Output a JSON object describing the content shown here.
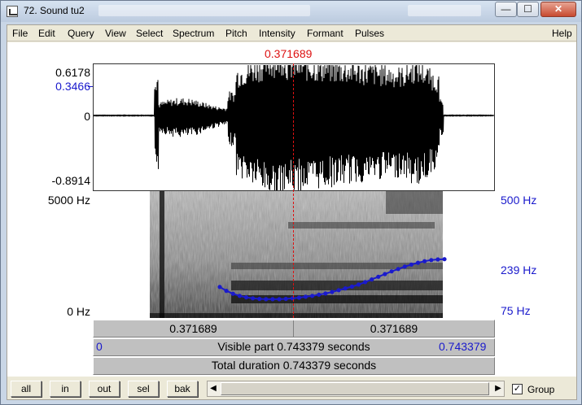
{
  "window": {
    "title": "72. Sound tu2",
    "controls": {
      "minimize": "—",
      "maximize": "☐",
      "close": "✕"
    }
  },
  "menu": [
    "File",
    "Edit",
    "Query",
    "View",
    "Select",
    "Spectrum",
    "Pitch",
    "Intensity",
    "Formant",
    "Pulses",
    "Help"
  ],
  "cursor": {
    "time": "0.371689",
    "color": "#dd1111"
  },
  "waveform": {
    "y_max": "0.6178",
    "y_marker": "0.3466",
    "y_zero": "0",
    "y_min": "-0.8914"
  },
  "spectrogram": {
    "freq_max": "5000 Hz",
    "freq_min": "0 Hz"
  },
  "pitch": {
    "ceiling": "500 Hz",
    "current": "239 Hz",
    "floor": "75 Hz",
    "color": "#1a1acc",
    "contour_hz": [
      239,
      226,
      216,
      209,
      204,
      201,
      199,
      198,
      198,
      198,
      199,
      201,
      203,
      206,
      209,
      213,
      217,
      222,
      228,
      234,
      240,
      247,
      255,
      264,
      273,
      282,
      291,
      299,
      307,
      314,
      320,
      325,
      329,
      331,
      332
    ]
  },
  "bars": {
    "left_time": "0.371689",
    "right_time": "0.371689",
    "visible_start": "0",
    "visible_label": "Visible part 0.743379 seconds",
    "visible_end": "0.743379",
    "total_label": "Total duration 0.743379 seconds"
  },
  "buttons": [
    "all",
    "in",
    "out",
    "sel",
    "bak"
  ],
  "group": {
    "label": "Group",
    "checked": "✓"
  }
}
